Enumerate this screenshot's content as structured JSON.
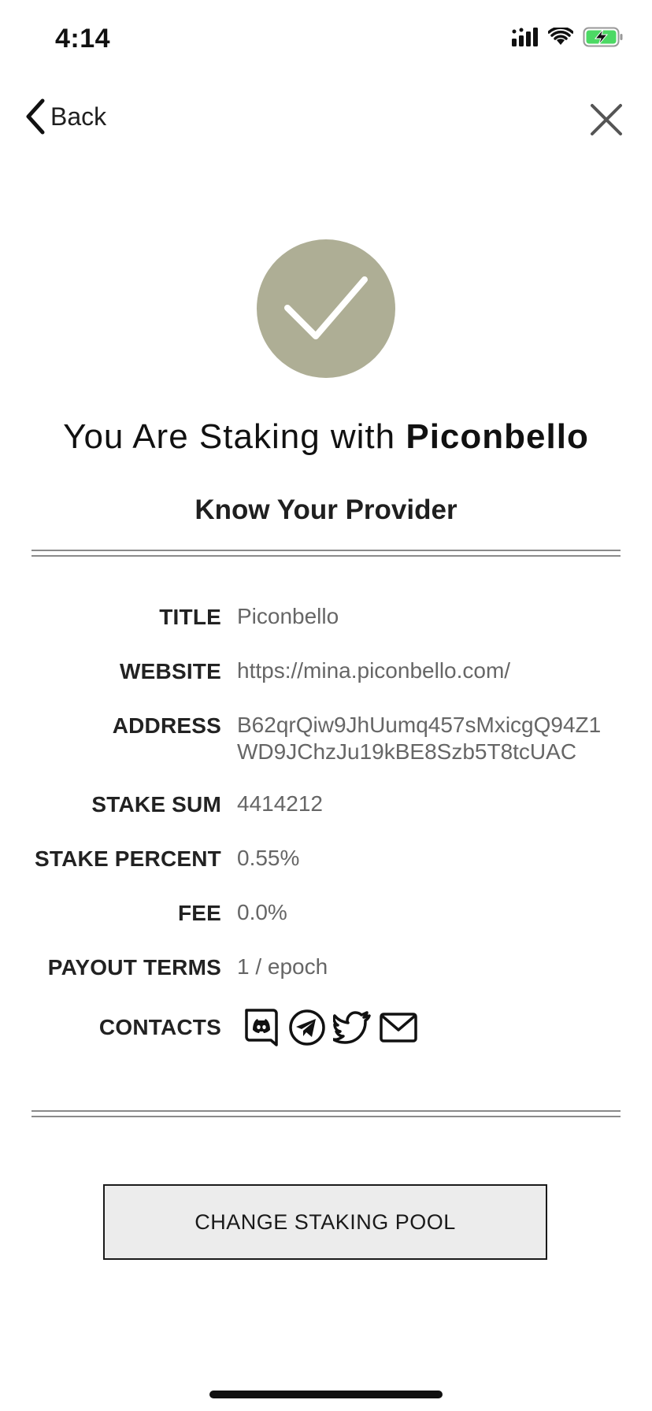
{
  "status_bar": {
    "time": "4:14"
  },
  "nav": {
    "back_label": "Back"
  },
  "hero": {
    "headline_prefix": "You Are Staking with ",
    "headline_provider": "Piconbello",
    "subheadline": "Know Your Provider",
    "check_color": "#aeae95"
  },
  "provider": {
    "title_label": "TITLE",
    "title_value": "Piconbello",
    "website_label": "WEBSITE",
    "website_value": "https://mina.piconbello.com/",
    "address_label": "ADDRESS",
    "address_line1": "B62qrQiw9JhUumq457sMxicgQ94Z1",
    "address_line2": "WD9JChzJu19kBE8Szb5T8tcUAC",
    "stake_sum_label": "STAKE SUM",
    "stake_sum_value": "4414212",
    "stake_percent_label": "STAKE PERCENT",
    "stake_percent_value": "0.55%",
    "fee_label": "FEE",
    "fee_value": "0.0%",
    "payout_terms_label": "PAYOUT TERMS",
    "payout_terms_value": "1 / epoch",
    "contacts_label": "CONTACTS",
    "contacts": [
      "discord-icon",
      "telegram-icon",
      "twitter-icon",
      "mail-icon"
    ]
  },
  "actions": {
    "change_pool_label": "CHANGE STAKING POOL"
  }
}
